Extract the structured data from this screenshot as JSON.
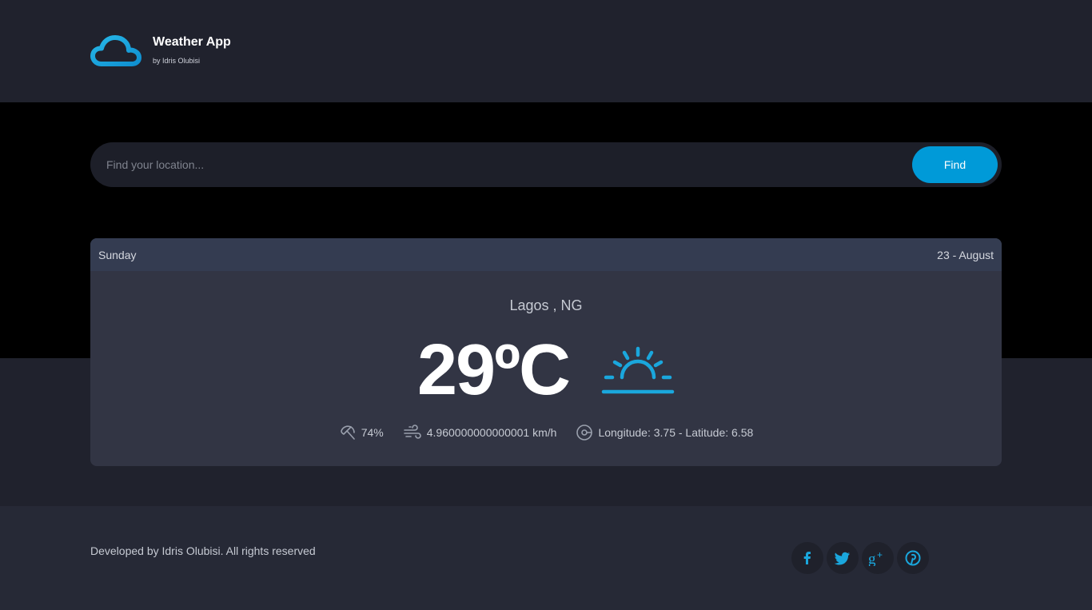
{
  "brand": {
    "title": "Weather App",
    "subtitle": "by Idris Olubisi",
    "icon": "cloud-icon"
  },
  "search": {
    "placeholder": "Find your location...",
    "value": "",
    "button_label": "Find"
  },
  "forecast": {
    "day": "Sunday",
    "date": "23 - August",
    "location": "Lagos , NG",
    "temperature": "29ºC",
    "condition_icon": "sunrise-icon",
    "humidity": "74%",
    "wind": "4.960000000000001 km/h",
    "coordinates": "Longitude: 3.75 - Latitude: 6.58"
  },
  "footer": {
    "copyright": "Developed by Idris Olubisi. All rights reserved",
    "social": [
      {
        "name": "facebook-icon"
      },
      {
        "name": "twitter-icon"
      },
      {
        "name": "google-plus-icon"
      },
      {
        "name": "pinterest-icon"
      }
    ]
  },
  "colors": {
    "accent": "#009ad8",
    "icon_blue": "#1aa7dd",
    "header_bg": "#20222d",
    "hero_bg": "#000000",
    "card_bg": "#323544",
    "card_header_bg": "#343c51",
    "footer_bg": "#262936"
  }
}
